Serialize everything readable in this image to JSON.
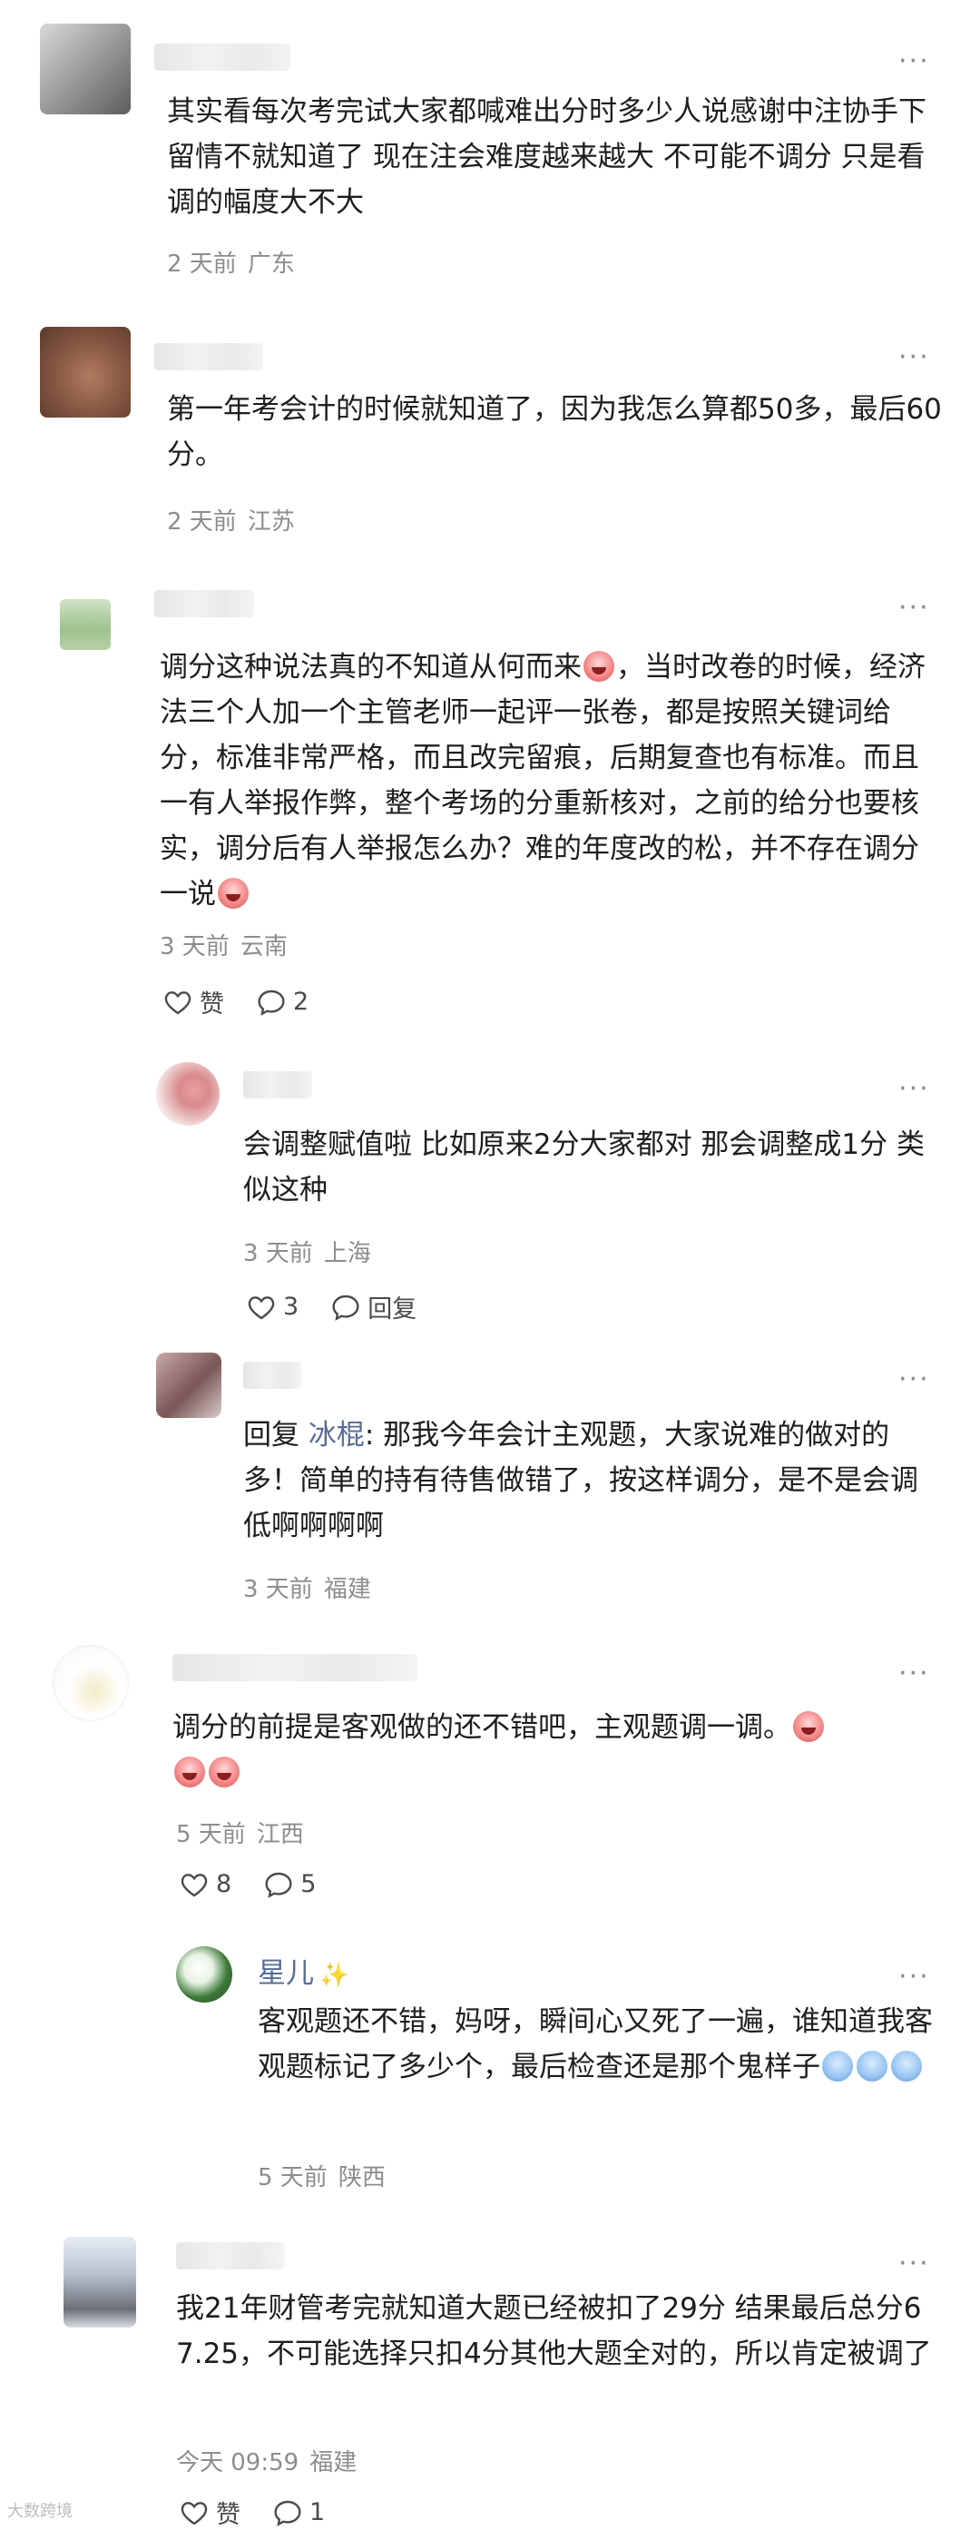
{
  "comments": [
    {
      "text": "其实看每次考完试大家都喊难出分时多少人说感谢中注协手下留情不就知道了 现在注会难度越来越大 不可能不调分 只是看调的幅度大不大",
      "time": "2 天前",
      "location": "广东"
    },
    {
      "text": "第一年考会计的时候就知道了，因为我怎么算都50多，最后60分。",
      "time": "2 天前",
      "location": "江苏"
    },
    {
      "text_a": "调分这种说法真的不知道从何而来",
      "text_b": "，当时改卷的时候，经济法三个人加一个主管老师一起评一张卷，都是按照关键词给分，标准非常严格，而且改完留痕，后期复查也有标准。而且一有人举报作弊，整个考场的分重新核对，之前的给分也要核实，调分后有人举报怎么办？难的年度改的松，并不存在调分一说",
      "time": "3 天前",
      "location": "云南",
      "like_label": "赞",
      "reply_count": "2",
      "replies": [
        {
          "text": "会调整赋值啦 比如原来2分大家都对 那会调整成1分 类似这种",
          "time": "3 天前",
          "location": "上海",
          "like_count": "3",
          "reply_label": "回复"
        },
        {
          "reply_prefix": "回复",
          "mention": "冰棍",
          "text": ": 那我今年会计主观题，大家说难的做对的多！简单的持有待售做错了，按这样调分，是不是会调低啊啊啊啊",
          "time": "3 天前",
          "location": "福建"
        }
      ]
    },
    {
      "text": "调分的前提是客观做的还不错吧，主观题调一调。",
      "time": "5 天前",
      "location": "江西",
      "like_count": "8",
      "reply_count": "5",
      "replies": [
        {
          "name": "星儿",
          "text": "客观题还不错，妈呀，瞬间心又死了一遍，谁知道我客观题标记了多少个，最后检查还是那个鬼样子",
          "time": "5 天前",
          "location": "陕西"
        }
      ]
    },
    {
      "text": "我21年财管考完就知道大题已经被扣了29分 结果最后总分67.25，不可能选择只扣4分其他大题全对的，所以肯定被调了",
      "time": "今天 09:59",
      "location": "福建",
      "like_label": "赞",
      "reply_count": "1"
    }
  ],
  "more_label": "···",
  "watermark": "大数跨境",
  "colors": {
    "mention": "#576b95",
    "meta": "#8d8d8d"
  }
}
